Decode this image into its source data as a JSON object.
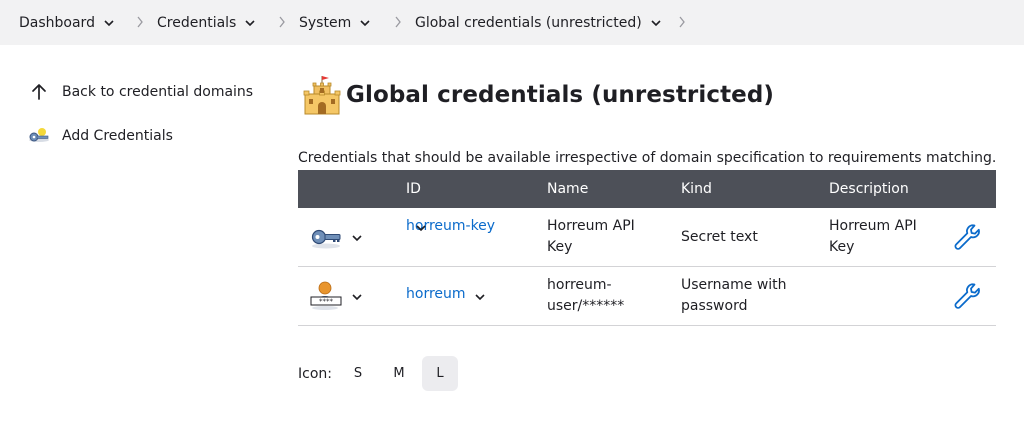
{
  "breadcrumb": {
    "items": [
      {
        "label": "Dashboard"
      },
      {
        "label": "Credentials"
      },
      {
        "label": "System"
      },
      {
        "label": "Global credentials (unrestricted)"
      }
    ]
  },
  "sidebar": {
    "items": [
      {
        "label": "Back to credential domains",
        "icon": "arrow-up-icon"
      },
      {
        "label": "Add Credentials",
        "icon": "key-icon"
      }
    ]
  },
  "main": {
    "title": "Global credentials (unrestricted)",
    "title_icon": "castle-icon",
    "description": "Credentials that should be available irrespective of domain specification to requirements matching.",
    "table": {
      "headers": [
        "ID",
        "Name",
        "Kind",
        "Description"
      ],
      "rows": [
        {
          "icon": "key-icon",
          "id": "horreum-key",
          "name_line1": "Horreum API",
          "name_line2": "Key",
          "kind_line1": "Secret text",
          "kind_line2": "",
          "desc_line1": "Horreum API",
          "desc_line2": "Key"
        },
        {
          "icon": "user-password-icon",
          "id": "horreum",
          "name_line1": "horreum-",
          "name_line2": "user/******",
          "kind_line1": "Username with",
          "kind_line2": "password",
          "desc_line1": "",
          "desc_line2": ""
        }
      ]
    },
    "icon_size": {
      "label": "Icon:",
      "options": [
        "S",
        "M",
        "L"
      ],
      "selected": "L"
    }
  },
  "colors": {
    "header_bg": "#4d5058",
    "link": "#0b6bcb",
    "breadcrumb_bg": "#f2f2f3"
  }
}
